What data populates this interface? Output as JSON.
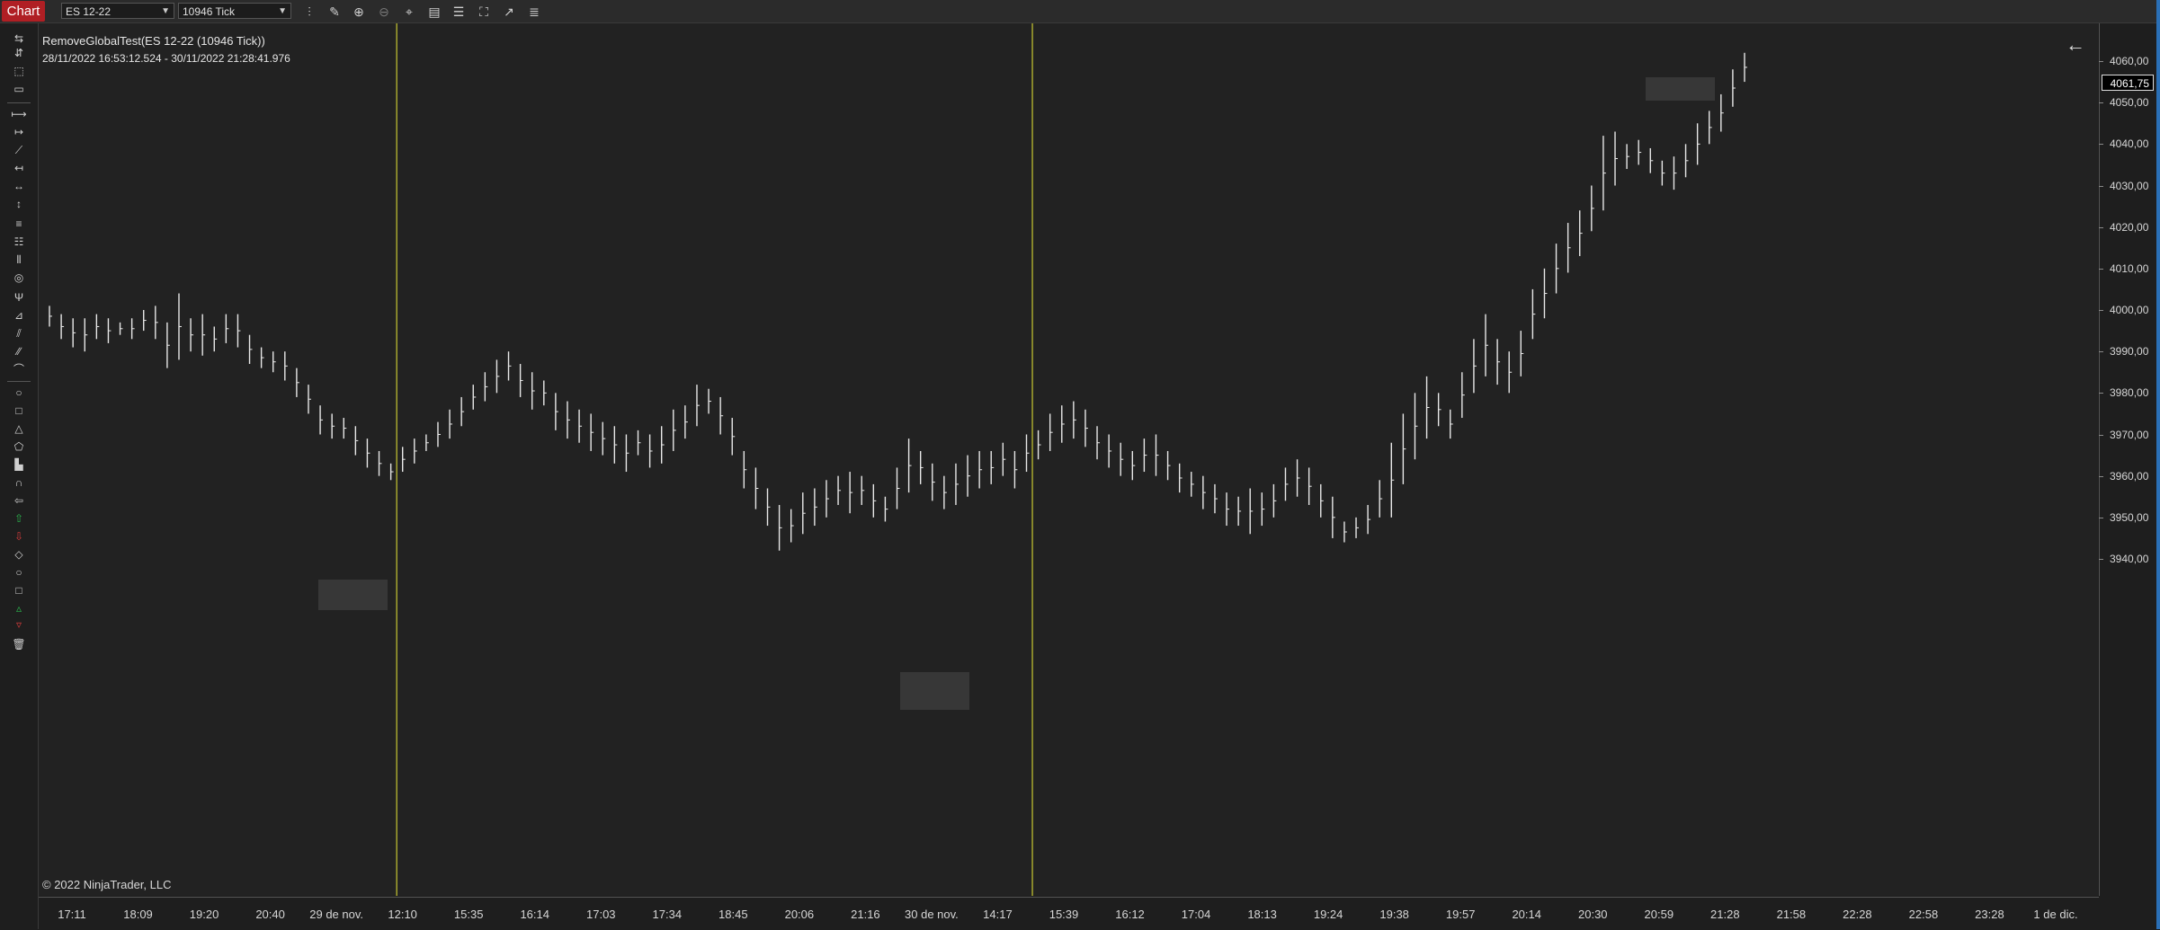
{
  "toolbar": {
    "tab_label": "Chart",
    "instrument": "ES 12-22",
    "interval": "10946 Tick",
    "icons": [
      "bar-type-icon",
      "pencil-icon",
      "zoom-in-icon",
      "zoom-out-icon",
      "crosshair-icon",
      "data-box-icon",
      "properties-icon",
      "snapshot-icon",
      "strategies-icon",
      "indicators-icon"
    ]
  },
  "side_toolbar": {
    "icons": [
      "cursor-icon",
      "scroll-icon",
      "select-icon",
      "region-icon",
      "line-icon",
      "ray-icon",
      "extended-line-icon",
      "arrow-line-icon",
      "horizontal-line-icon",
      "vertical-line-icon",
      "fibonacci-retracement-icon",
      "fibonacci-extension-icon",
      "fibonacci-time-icon",
      "fibonacci-circle-icon",
      "andrews-pitchfork-icon",
      "gann-fan-icon",
      "regression-channel-icon",
      "trend-channel-icon",
      "arc-icon",
      "ellipse-icon",
      "rectangle-icon",
      "triangle-icon",
      "polygon-icon",
      "risk-reward-icon",
      "arc-icon",
      "arrow-icon",
      "arrow-up-icon",
      "arrow-down-icon",
      "diamond-icon",
      "dot-icon",
      "square-icon",
      "triangle-up-icon",
      "triangle-down-icon",
      "trash-icon"
    ]
  },
  "chart": {
    "strategy_title": "RemoveGlobalTest(ES 12-22 (10946 Tick))",
    "date_range": "28/11/2022 16:53:12.524 - 30/11/2022 21:28:41.976",
    "copyright": "© 2022 NinjaTrader, LLC",
    "last_price": "4061,75",
    "price_ticks": [
      "4060,00",
      "4050,00",
      "4040,00",
      "4030,00",
      "4020,00",
      "4010,00",
      "4000,00",
      "3990,00",
      "3980,00",
      "3970,00",
      "3960,00",
      "3950,00",
      "3940,00"
    ],
    "time_ticks": [
      "17:11",
      "18:09",
      "19:20",
      "20:40",
      "29 de nov.",
      "12:10",
      "15:35",
      "16:14",
      "17:03",
      "17:34",
      "18:45",
      "20:06",
      "21:16",
      "30 de nov.",
      "14:17",
      "15:39",
      "16:12",
      "17:04",
      "18:13",
      "19:24",
      "19:38",
      "19:57",
      "20:14",
      "20:30",
      "20:59",
      "21:28",
      "21:58",
      "22:28",
      "22:58",
      "23:28",
      "1 de dic."
    ],
    "colors": {
      "bars": "#e8e8e8",
      "session_line": "#c8c832",
      "background": "#222222"
    }
  },
  "chart_data": {
    "type": "bar",
    "ylim": [
      3935,
      4065
    ],
    "xlabel": "",
    "ylabel": "",
    "session_breaks_at_bar": [
      30,
      84
    ],
    "bars": [
      [
        4001,
        3996
      ],
      [
        3999,
        3993
      ],
      [
        3998,
        3991
      ],
      [
        3998,
        3990
      ],
      [
        3999,
        3993
      ],
      [
        3998,
        3992
      ],
      [
        3997,
        3994
      ],
      [
        3998,
        3993
      ],
      [
        4000,
        3995
      ],
      [
        4001,
        3993
      ],
      [
        3997,
        3986
      ],
      [
        4004,
        3988
      ],
      [
        3998,
        3990
      ],
      [
        3999,
        3989
      ],
      [
        3996,
        3990
      ],
      [
        3999,
        3992
      ],
      [
        3999,
        3991
      ],
      [
        3994,
        3987
      ],
      [
        3991,
        3986
      ],
      [
        3990,
        3985
      ],
      [
        3990,
        3983
      ],
      [
        3986,
        3979
      ],
      [
        3982,
        3975
      ],
      [
        3977,
        3970
      ],
      [
        3975,
        3969
      ],
      [
        3974,
        3969
      ],
      [
        3972,
        3965
      ],
      [
        3969,
        3962
      ],
      [
        3966,
        3960
      ],
      [
        3963,
        3959
      ],
      [
        3967,
        3961
      ],
      [
        3969,
        3963
      ],
      [
        3970,
        3966
      ],
      [
        3973,
        3967
      ],
      [
        3976,
        3969
      ],
      [
        3979,
        3972
      ],
      [
        3982,
        3976
      ],
      [
        3985,
        3978
      ],
      [
        3988,
        3980
      ],
      [
        3990,
        3983
      ],
      [
        3987,
        3979
      ],
      [
        3985,
        3976
      ],
      [
        3983,
        3977
      ],
      [
        3980,
        3971
      ],
      [
        3978,
        3969
      ],
      [
        3976,
        3968
      ],
      [
        3975,
        3966
      ],
      [
        3973,
        3965
      ],
      [
        3972,
        3963
      ],
      [
        3970,
        3961
      ],
      [
        3971,
        3965
      ],
      [
        3970,
        3962
      ],
      [
        3972,
        3963
      ],
      [
        3976,
        3966
      ],
      [
        3977,
        3969
      ],
      [
        3982,
        3972
      ],
      [
        3981,
        3975
      ],
      [
        3979,
        3970
      ],
      [
        3974,
        3965
      ],
      [
        3966,
        3957
      ],
      [
        3962,
        3952
      ],
      [
        3957,
        3948
      ],
      [
        3953,
        3942
      ],
      [
        3952,
        3944
      ],
      [
        3956,
        3946
      ],
      [
        3957,
        3948
      ],
      [
        3959,
        3950
      ],
      [
        3960,
        3953
      ],
      [
        3961,
        3951
      ],
      [
        3960,
        3953
      ],
      [
        3958,
        3950
      ],
      [
        3955,
        3949
      ],
      [
        3962,
        3952
      ],
      [
        3969,
        3956
      ],
      [
        3966,
        3958
      ],
      [
        3963,
        3954
      ],
      [
        3960,
        3952
      ],
      [
        3963,
        3953
      ],
      [
        3965,
        3955
      ],
      [
        3966,
        3957
      ],
      [
        3966,
        3958
      ],
      [
        3968,
        3960
      ],
      [
        3966,
        3957
      ],
      [
        3970,
        3961
      ],
      [
        3971,
        3964
      ],
      [
        3975,
        3966
      ],
      [
        3977,
        3968
      ],
      [
        3978,
        3969
      ],
      [
        3976,
        3967
      ],
      [
        3972,
        3964
      ],
      [
        3970,
        3962
      ],
      [
        3968,
        3960
      ],
      [
        3966,
        3959
      ],
      [
        3969,
        3961
      ],
      [
        3970,
        3960
      ],
      [
        3966,
        3959
      ],
      [
        3963,
        3956
      ],
      [
        3961,
        3955
      ],
      [
        3960,
        3952
      ],
      [
        3958,
        3951
      ],
      [
        3956,
        3948
      ],
      [
        3955,
        3948
      ],
      [
        3957,
        3946
      ],
      [
        3956,
        3948
      ],
      [
        3958,
        3950
      ],
      [
        3962,
        3954
      ],
      [
        3964,
        3955
      ],
      [
        3962,
        3953
      ],
      [
        3958,
        3950
      ],
      [
        3955,
        3945
      ],
      [
        3949,
        3944
      ],
      [
        3950,
        3945
      ],
      [
        3953,
        3946
      ],
      [
        3959,
        3950
      ],
      [
        3968,
        3950
      ],
      [
        3975,
        3958
      ],
      [
        3980,
        3964
      ],
      [
        3984,
        3969
      ],
      [
        3980,
        3972
      ],
      [
        3976,
        3969
      ],
      [
        3985,
        3974
      ],
      [
        3993,
        3980
      ],
      [
        3999,
        3984
      ],
      [
        3993,
        3982
      ],
      [
        3990,
        3980
      ],
      [
        3995,
        3984
      ],
      [
        4005,
        3993
      ],
      [
        4010,
        3998
      ],
      [
        4016,
        4004
      ],
      [
        4021,
        4009
      ],
      [
        4024,
        4013
      ],
      [
        4030,
        4019
      ],
      [
        4042,
        4024
      ],
      [
        4043,
        4030
      ],
      [
        4040,
        4034
      ],
      [
        4041,
        4035
      ],
      [
        4039,
        4033
      ],
      [
        4036,
        4030
      ],
      [
        4037,
        4029
      ],
      [
        4040,
        4032
      ],
      [
        4045,
        4035
      ],
      [
        4048,
        4040
      ],
      [
        4052,
        4043
      ],
      [
        4058,
        4049
      ],
      [
        4062,
        4055
      ]
    ]
  }
}
